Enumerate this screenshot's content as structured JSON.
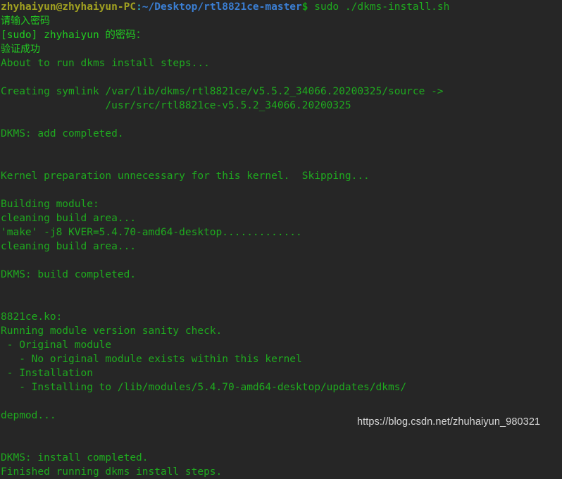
{
  "terminal": {
    "background_color": "#262626",
    "default_text_color": "#1faa1f",
    "bright_text_color": "#22cc22",
    "prompt": {
      "user_host": "zhyhaiyun@zhyhaiyun-PC",
      "user_host_color": "#a2a221",
      "separator": ":",
      "separator_color": "#2a9fb5",
      "path": "~/Desktop/rtl8821ce-master",
      "path_color": "#3b7fd4",
      "symbol": "$",
      "symbol_color": "#16a016",
      "command": " sudo ./dkms-install.sh",
      "command_color": "#1faa1f"
    },
    "lines": [
      {
        "id": "l01",
        "text": "请输入密码",
        "style": "cjk"
      },
      {
        "id": "l02",
        "text": "[sudo] zhyhaiyun 的密码：",
        "style": "mixed"
      },
      {
        "id": "l03",
        "text": "验证成功",
        "style": "cjk"
      },
      {
        "id": "l04",
        "text": "About to run dkms install steps...",
        "style": "plain"
      },
      {
        "id": "l05",
        "text": "",
        "style": "blank"
      },
      {
        "id": "l06",
        "text": "Creating symlink /var/lib/dkms/rtl8821ce/v5.5.2_34066.20200325/source ->",
        "style": "plain"
      },
      {
        "id": "l07",
        "text": "                 /usr/src/rtl8821ce-v5.5.2_34066.20200325",
        "style": "plain"
      },
      {
        "id": "l08",
        "text": "",
        "style": "blank"
      },
      {
        "id": "l09",
        "text": "DKMS: add completed.",
        "style": "plain"
      },
      {
        "id": "l10",
        "text": "",
        "style": "blank"
      },
      {
        "id": "l11",
        "text": "",
        "style": "blank"
      },
      {
        "id": "l12",
        "text": "Kernel preparation unnecessary for this kernel.  Skipping...",
        "style": "plain"
      },
      {
        "id": "l13",
        "text": "",
        "style": "blank"
      },
      {
        "id": "l14",
        "text": "Building module:",
        "style": "plain"
      },
      {
        "id": "l15",
        "text": "cleaning build area...",
        "style": "plain"
      },
      {
        "id": "l16",
        "text": "'make' -j8 KVER=5.4.70-amd64-desktop.............",
        "style": "plain"
      },
      {
        "id": "l17",
        "text": "cleaning build area...",
        "style": "plain"
      },
      {
        "id": "l18",
        "text": "",
        "style": "blank"
      },
      {
        "id": "l19",
        "text": "DKMS: build completed.",
        "style": "plain"
      },
      {
        "id": "l20",
        "text": "",
        "style": "blank"
      },
      {
        "id": "l21",
        "text": "",
        "style": "blank"
      },
      {
        "id": "l22",
        "text": "8821ce.ko:",
        "style": "plain"
      },
      {
        "id": "l23",
        "text": "Running module version sanity check.",
        "style": "plain"
      },
      {
        "id": "l24",
        "text": " - Original module",
        "style": "plain"
      },
      {
        "id": "l25",
        "text": "   - No original module exists within this kernel",
        "style": "plain"
      },
      {
        "id": "l26",
        "text": " - Installation",
        "style": "plain"
      },
      {
        "id": "l27",
        "text": "   - Installing to /lib/modules/5.4.70-amd64-desktop/updates/dkms/",
        "style": "plain"
      },
      {
        "id": "l28",
        "text": "",
        "style": "blank"
      },
      {
        "id": "l29",
        "text": "depmod...",
        "style": "plain"
      },
      {
        "id": "l30",
        "text": "",
        "style": "blank"
      },
      {
        "id": "l31",
        "text": "",
        "style": "blank"
      },
      {
        "id": "l32",
        "text": "DKMS: install completed.",
        "style": "plain"
      },
      {
        "id": "l33",
        "text": "Finished running dkms install steps.",
        "style": "plain"
      }
    ]
  },
  "watermark": {
    "text": "https://blog.csdn.net/zhuhaiyun_980321",
    "color": "#d8d8d8"
  }
}
